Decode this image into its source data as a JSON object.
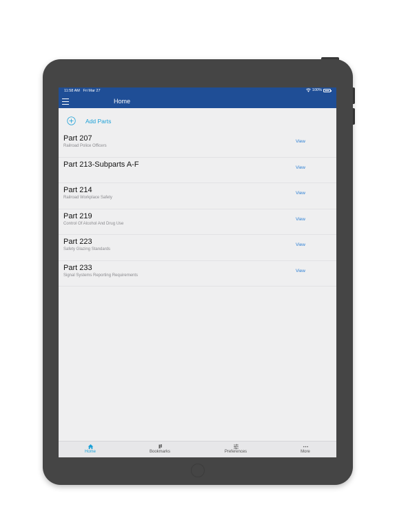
{
  "status_bar": {
    "time": "11:58 AM",
    "date": "Fri Mar 27",
    "battery": "100%"
  },
  "nav": {
    "title": "Home"
  },
  "add_parts": {
    "label": "Add Parts"
  },
  "parts": [
    {
      "title": "Part 207",
      "subtitle": "Railroad Police Officers",
      "action": "View"
    },
    {
      "title": "Part 213-Subparts A-F",
      "subtitle": "",
      "action": "View"
    },
    {
      "title": "Part 214",
      "subtitle": "Railroad Workplace Safety",
      "action": "View"
    },
    {
      "title": "Part 219",
      "subtitle": "Control Of Alcohol And Drug Use",
      "action": "View"
    },
    {
      "title": "Part 223",
      "subtitle": "Safety Glazing Standards",
      "action": "View"
    },
    {
      "title": "Part 233",
      "subtitle": "Signal Systems Reporting Requirements",
      "action": "View"
    }
  ],
  "tabs": [
    {
      "label": "Home",
      "icon": "home-icon",
      "active": true
    },
    {
      "label": "Bookmarks",
      "icon": "bookmarks-icon",
      "active": false
    },
    {
      "label": "Preferences",
      "icon": "sliders-icon",
      "active": false
    },
    {
      "label": "More",
      "icon": "more-icon",
      "active": false
    }
  ],
  "colors": {
    "nav_background": "#1f4e96",
    "accent": "#1ba0d7",
    "link": "#2b7fd4",
    "screen_background": "#efeff0",
    "device_frame": "#454545"
  }
}
